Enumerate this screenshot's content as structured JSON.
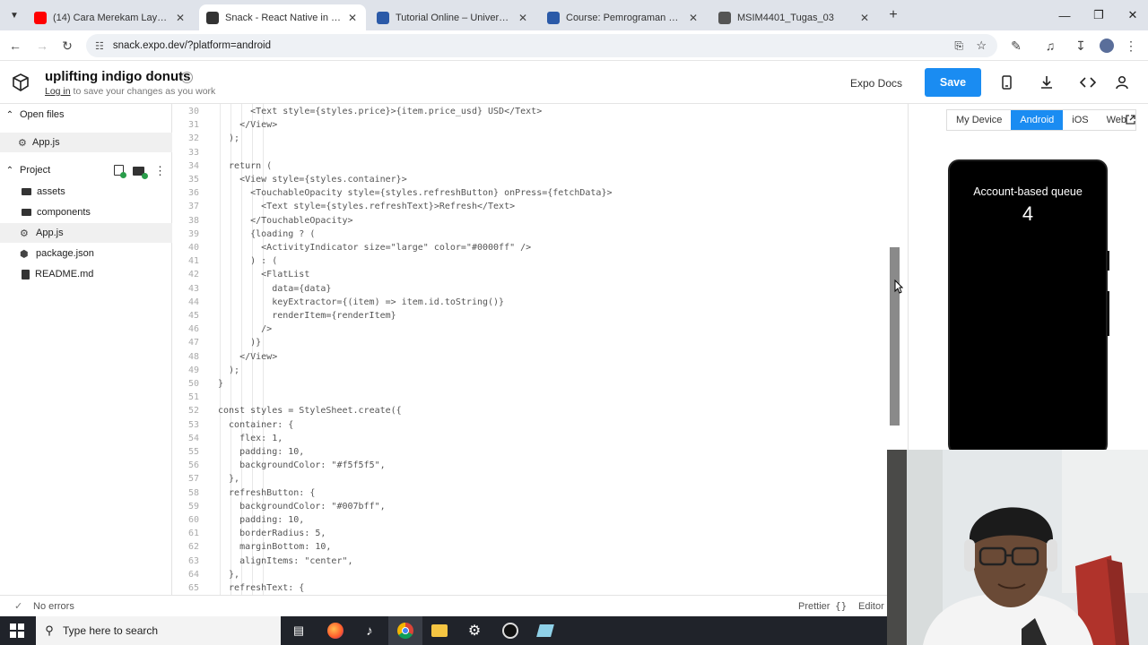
{
  "browser": {
    "tabs": [
      {
        "title": "(14) Cara Merekam Layar Lapto",
        "color": "#ff0000"
      },
      {
        "title": "Snack - React Native in the brow",
        "color": "#333333",
        "active": true
      },
      {
        "title": "Tutorial Online – Universitas Te",
        "color": "#2b5aa8"
      },
      {
        "title": "Course: Pemrograman Berbasis",
        "color": "#2b5aa8"
      },
      {
        "title": "MSIM4401_Tugas_03",
        "color": "#555555"
      }
    ],
    "url": "snack.expo.dev/?platform=android"
  },
  "header": {
    "project_name": "uplifting indigo donuts",
    "login_link": "Log in",
    "login_suffix": "to save your changes as you work",
    "docs_label": "Expo Docs",
    "save_label": "Save"
  },
  "sidebar": {
    "open_files_label": "Open files",
    "open_files": [
      "App.js"
    ],
    "project_label": "Project",
    "project_items": [
      {
        "name": "assets",
        "type": "folder"
      },
      {
        "name": "components",
        "type": "folder"
      },
      {
        "name": "App.js",
        "type": "file",
        "selected": true
      },
      {
        "name": "package.json",
        "type": "file"
      },
      {
        "name": "README.md",
        "type": "file"
      }
    ]
  },
  "editor": {
    "lines": [
      {
        "n": "30",
        "ind": 3,
        "t": "<Text style={styles.price}>{item.price_usd} USD</Text>"
      },
      {
        "n": "31",
        "ind": 2,
        "t": "</View>"
      },
      {
        "n": "32",
        "ind": 1,
        "t": ");"
      },
      {
        "n": "33",
        "ind": 0,
        "t": ""
      },
      {
        "n": "34",
        "ind": 1,
        "t": "return ("
      },
      {
        "n": "35",
        "ind": 2,
        "t": "<View style={styles.container}>"
      },
      {
        "n": "36",
        "ind": 3,
        "t": "<TouchableOpacity style={styles.refreshButton} onPress={fetchData}>"
      },
      {
        "n": "37",
        "ind": 4,
        "t": "<Text style={styles.refreshText}>Refresh</Text>"
      },
      {
        "n": "38",
        "ind": 3,
        "t": "</TouchableOpacity>"
      },
      {
        "n": "39",
        "ind": 3,
        "t": "{loading ? ("
      },
      {
        "n": "40",
        "ind": 4,
        "t": "<ActivityIndicator size=\"large\" color=\"#0000ff\" />"
      },
      {
        "n": "41",
        "ind": 3,
        "t": ") : ("
      },
      {
        "n": "42",
        "ind": 4,
        "t": "<FlatList"
      },
      {
        "n": "43",
        "ind": 5,
        "t": "data={data}"
      },
      {
        "n": "44",
        "ind": 5,
        "t": "keyExtractor={(item) => item.id.toString()}"
      },
      {
        "n": "45",
        "ind": 5,
        "t": "renderItem={renderItem}"
      },
      {
        "n": "46",
        "ind": 4,
        "t": "/>"
      },
      {
        "n": "47",
        "ind": 3,
        "t": ")}"
      },
      {
        "n": "48",
        "ind": 2,
        "t": "</View>"
      },
      {
        "n": "49",
        "ind": 1,
        "t": ");"
      },
      {
        "n": "50",
        "ind": 0,
        "t": "}"
      },
      {
        "n": "51",
        "ind": 0,
        "t": ""
      },
      {
        "n": "52",
        "ind": 0,
        "t": "const styles = StyleSheet.create({"
      },
      {
        "n": "53",
        "ind": 1,
        "t": "container: {"
      },
      {
        "n": "54",
        "ind": 2,
        "t": "flex: 1,"
      },
      {
        "n": "55",
        "ind": 2,
        "t": "padding: 10,"
      },
      {
        "n": "56",
        "ind": 2,
        "t": "backgroundColor: \"#f5f5f5\","
      },
      {
        "n": "57",
        "ind": 1,
        "t": "},"
      },
      {
        "n": "58",
        "ind": 1,
        "t": "refreshButton: {"
      },
      {
        "n": "59",
        "ind": 2,
        "t": "backgroundColor: \"#007bff\","
      },
      {
        "n": "60",
        "ind": 2,
        "t": "padding: 10,"
      },
      {
        "n": "61",
        "ind": 2,
        "t": "borderRadius: 5,"
      },
      {
        "n": "62",
        "ind": 2,
        "t": "marginBottom: 10,"
      },
      {
        "n": "63",
        "ind": 2,
        "t": "alignItems: \"center\","
      },
      {
        "n": "64",
        "ind": 1,
        "t": "},"
      },
      {
        "n": "65",
        "ind": 1,
        "t": "refreshText: {"
      }
    ]
  },
  "statusbar": {
    "errors": "No errors",
    "prettier": "Prettier",
    "editor": "Editor"
  },
  "device": {
    "tabs": [
      "My Device",
      "Android",
      "iOS",
      "Web"
    ],
    "active_tab": "Android",
    "screen_title": "Account-based queue",
    "screen_count": "4"
  },
  "taskbar": {
    "search_placeholder": "Type here to search"
  }
}
